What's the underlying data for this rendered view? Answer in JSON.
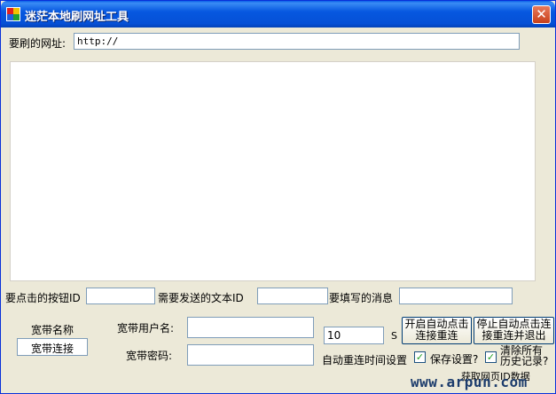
{
  "window": {
    "title": "迷茫本地刷网址工具",
    "close_glyph": "✕"
  },
  "url_row": {
    "label": "要刷的网址:",
    "value": "http://"
  },
  "id_row": {
    "button_id_label": "要点击的按钮ID",
    "button_id_value": "",
    "text_id_label": "需要发送的文本ID",
    "text_id_value": "",
    "message_label": "要填写的消息",
    "message_value": ""
  },
  "broadband": {
    "name_label": "宽带名称",
    "name_value": "宽带连接",
    "username_label": "宽带用户名:",
    "username_value": "",
    "password_label": "宽带密码:",
    "password_value": ""
  },
  "reconnect": {
    "interval_value": "10",
    "interval_unit": "S",
    "interval_label": "自动重连时间设置"
  },
  "buttons": {
    "start_line1": "开启自动点击",
    "start_line2": "连接重连",
    "stop_line1": "停止自动点击连",
    "stop_line2": "接重连并退出"
  },
  "options": {
    "save_settings_label": "保存设置?",
    "save_settings_checked": true,
    "clear_history_line1": "清除所有",
    "clear_history_line2": "历史记录?",
    "clear_history_checked": true
  },
  "status": {
    "fetch_text": "获取网页ID数据"
  },
  "watermark": {
    "text": "www.arpun.com"
  },
  "icons": {
    "app": "app-icon",
    "close": "close-icon",
    "check": "check-icon"
  },
  "colors": {
    "titlebar": "#0758e0",
    "close": "#c8411b",
    "face": "#ece9d8",
    "input_border": "#7f9db9"
  }
}
